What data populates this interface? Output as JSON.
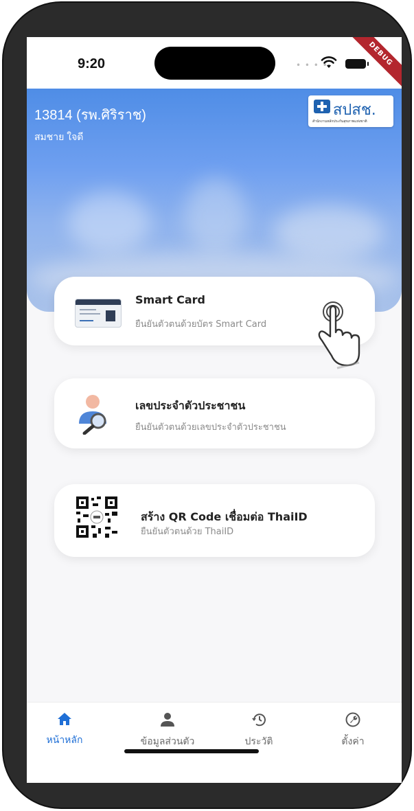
{
  "status_bar": {
    "time": "9:20",
    "debug_banner": "DEBUG"
  },
  "header": {
    "hospital": "13814 (รพ.ศิริราช)",
    "user": "สมชาย ใจดี",
    "logo": {
      "text": "สปสช.",
      "subtitle": "สำนักงานหลักประกันสุขภาพแห่งชาติ"
    }
  },
  "cards": [
    {
      "title": "Smart Card",
      "subtitle": "ยืนยันตัวตนด้วยบัตร Smart Card",
      "icon": "smart-card-icon"
    },
    {
      "title": "เลขประจำตัวประชาชน",
      "subtitle": "ยืนยันตัวตนด้วยเลขประจำตัวประชาชน",
      "icon": "person-search-icon"
    },
    {
      "title": "สร้าง QR Code เชื่อมต่อ ThaiID",
      "subtitle": "ยืนยันตัวตนด้วย ThaiID",
      "icon": "qr-code-icon"
    }
  ],
  "bottom_nav": [
    {
      "label": "หน้าหลัก",
      "icon": "home-icon",
      "active": true
    },
    {
      "label": "ข้อมูลส่วนตัว",
      "icon": "person-icon",
      "active": false
    },
    {
      "label": "ประวัติ",
      "icon": "history-icon",
      "active": false
    },
    {
      "label": "ตั้งค่า",
      "icon": "settings-wrench-icon",
      "active": false
    }
  ],
  "colors": {
    "accent": "#1f6fd6",
    "header_blue": "#4f8de6",
    "logo_blue": "#1f62b0",
    "debug_red": "#b3262e"
  }
}
